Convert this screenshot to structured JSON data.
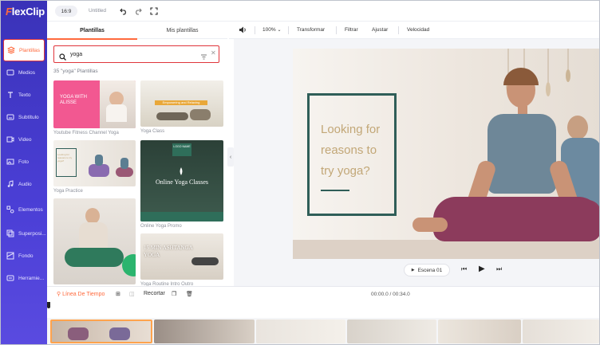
{
  "app": {
    "logo": "FlexClip"
  },
  "topbar": {
    "ratio": "16:9",
    "project_title": "Untitled"
  },
  "sidebar": {
    "items": [
      {
        "label": "Plantillas",
        "icon": "template-icon",
        "active": true
      },
      {
        "label": "Medios",
        "icon": "media-icon"
      },
      {
        "label": "Texto",
        "icon": "text-icon"
      },
      {
        "label": "Subtítulo",
        "icon": "subtitle-icon"
      },
      {
        "label": "Video",
        "icon": "video-icon"
      },
      {
        "label": "Foto",
        "icon": "photo-icon"
      },
      {
        "label": "Audio",
        "icon": "audio-icon"
      },
      {
        "label": "Elementos",
        "icon": "elements-icon"
      },
      {
        "label": "Superposi...",
        "icon": "overlay-icon"
      },
      {
        "label": "Fondo",
        "icon": "background-icon"
      },
      {
        "label": "Herramie...",
        "icon": "tools-icon"
      }
    ]
  },
  "panel": {
    "tabs": [
      {
        "label": "Plantillas",
        "active": true
      },
      {
        "label": "Mis plantillas"
      }
    ],
    "search": {
      "value": "yoga",
      "placeholder": ""
    },
    "result_count": "35 \"yoga\" Plantillas",
    "templates": [
      {
        "caption": "Youtube Fitness Channel Yoga",
        "overlay": "YOGA WITH ALISSE"
      },
      {
        "caption": "Yoga Class",
        "overlay": "Empowering and Relaxing"
      },
      {
        "caption": "Yoga Practice",
        "overlay": "Looking for reasons to try yoga?"
      },
      {
        "caption": "Online Yoga Promo",
        "overlay_top": "LOGO NAME",
        "overlay": "Online Yoga Classes"
      },
      {
        "caption": "",
        "overlay": ""
      },
      {
        "caption": "Yoga Routine Intro Outro",
        "overlay": "15 MIN ASHTANGA YOGA"
      }
    ]
  },
  "toolbar": {
    "volume_icon": "volume-icon",
    "zoom": "100%",
    "items": [
      "Transformar",
      "Filtrar",
      "Ajustar",
      "Velocidad"
    ]
  },
  "preview": {
    "quote": "Looking for reasons to try yoga?",
    "scene_label": "Escena 01"
  },
  "timeline": {
    "label": "Línea De Tiempo",
    "trim_label": "Recortar",
    "time": "00:00.0 / 00:34.0",
    "clip_count": 8
  },
  "colors": {
    "sidebar": "#4b3fd6",
    "accent": "#ff6a3d",
    "highlight": "#e0353b",
    "frame": "#2f5e58",
    "quote_text": "#c2a777"
  }
}
